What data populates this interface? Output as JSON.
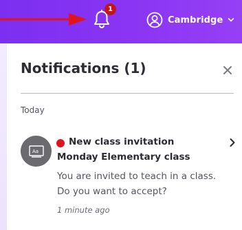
{
  "header": {
    "notification_count": "1",
    "account_name": "Cambridge",
    "colors": {
      "bar": "#8a35f3",
      "badge": "#c4141c",
      "annotation_arrow": "#e1141d"
    },
    "icons": {
      "bell": "bell-icon",
      "user": "user-circle-icon",
      "account_caret": "chevron-down-icon",
      "annotation": "red-arrow-annotation"
    }
  },
  "panel": {
    "title": "Notifications (1)",
    "close_icon": "close-icon",
    "groups": [
      {
        "label": "Today",
        "items": [
          {
            "title": "New class invitation",
            "subtitle": "Monday Elementary class",
            "body": "You are invited to teach in a class. Do you want to accept?",
            "time": "1 minute ago",
            "unread": true,
            "avatar_icon": "class-board-icon",
            "avatar_text": "Aa",
            "arrow_icon": "chevron-right-icon"
          }
        ]
      }
    ]
  }
}
